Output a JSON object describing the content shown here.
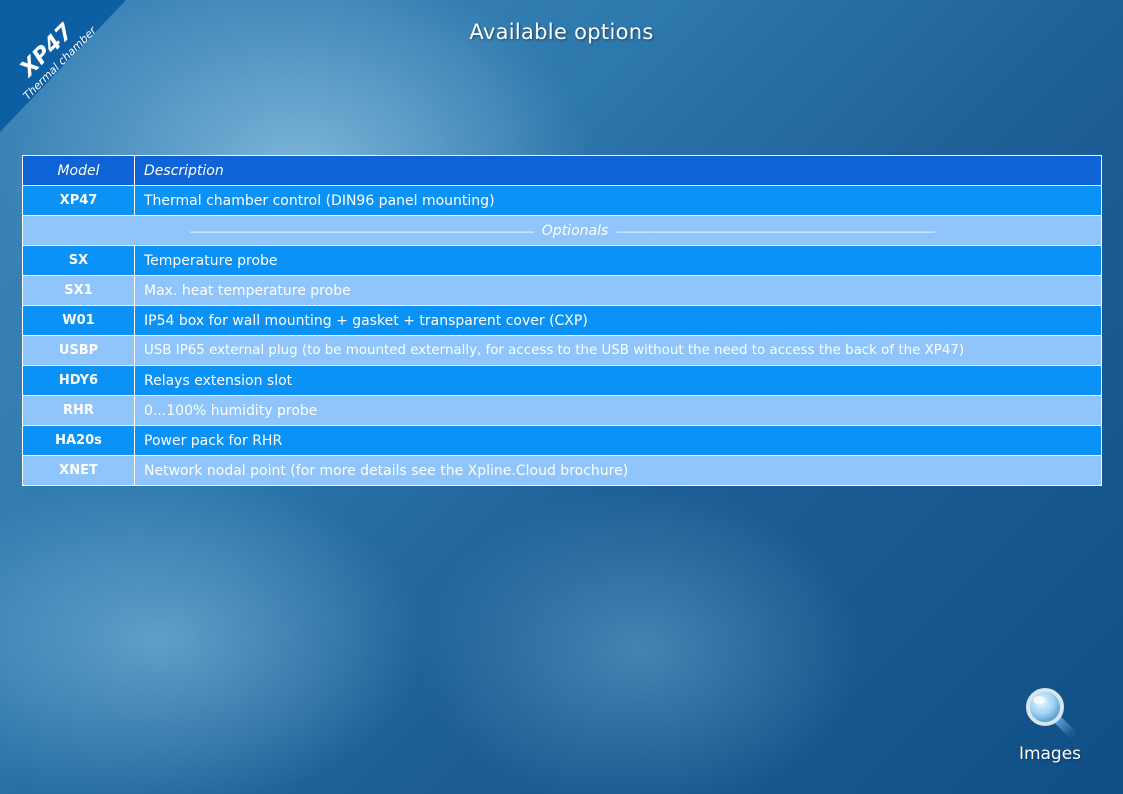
{
  "corner": {
    "model": "XP47",
    "subtitle": "Thermal chamber"
  },
  "title": "Available options",
  "table": {
    "headers": {
      "model": "Model",
      "description": "Description"
    },
    "main_row": {
      "model": "XP47",
      "description": "Thermal chamber control  (DIN96 panel mounting)"
    },
    "optionals_label": "Optionals",
    "options": [
      {
        "model": "SX",
        "description": "Temperature probe"
      },
      {
        "model": "SX1",
        "description": "Max. heat temperature probe"
      },
      {
        "model": "W01",
        "description": "IP54 box for wall mounting + gasket + transparent cover (CXP)"
      },
      {
        "model": "USBP",
        "description": "USB IP65 external plug  (to be mounted externally, for access to the USB without the need to access the back of the XP47)"
      },
      {
        "model": "HDY6",
        "description": "Relays extension slot"
      },
      {
        "model": "RHR",
        "description": "0...100% humidity probe"
      },
      {
        "model": "HA20s",
        "description": "Power pack for RHR"
      },
      {
        "model": "XNET",
        "description": "Network nodal point (for more details see the Xpline.Cloud brochure)"
      }
    ]
  },
  "images_button": {
    "label": "Images",
    "icon": "magnifier-icon"
  },
  "colors": {
    "header_row": "#0e64d6",
    "row_dark": "#0b92f7",
    "row_light": "#8fc5fb",
    "corner_banner": "#0c5fa3"
  }
}
